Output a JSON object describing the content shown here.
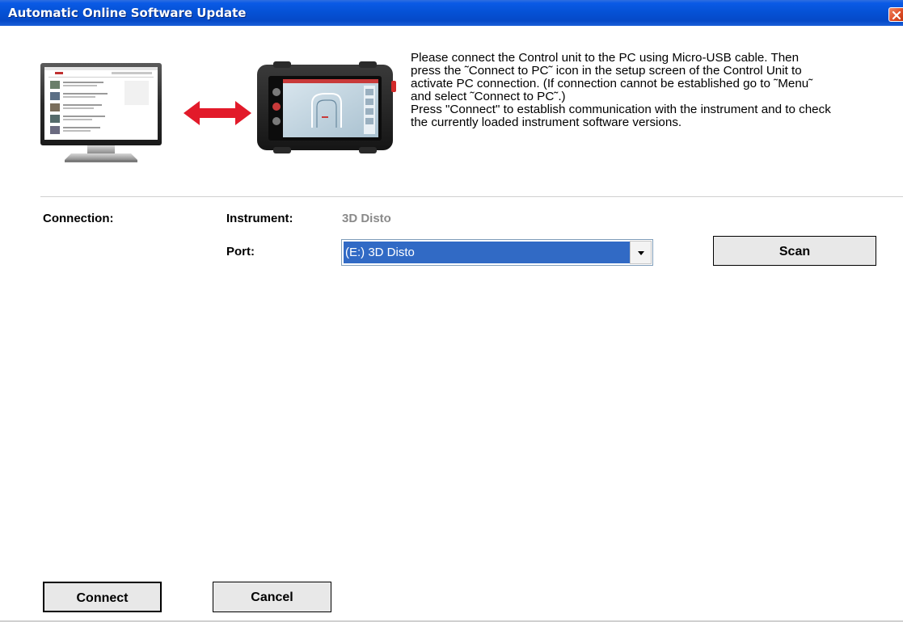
{
  "window": {
    "title": "Automatic Online Software Update"
  },
  "instructions": [
    "Please connect the Control unit to the PC using Micro-USB cable.  Then",
    "press the ˜Connect to PC˜ icon in the setup screen of the Control Unit to",
    "activate PC connection. (If connection cannot be established  go to ˜Menu˜",
    "and select ˜Connect to PC˜.)",
    "Press \"Connect\" to establish communication with the instrument and to check",
    "the currently loaded instrument software versions."
  ],
  "connection": {
    "section_label": "Connection:",
    "instrument_label": "Instrument:",
    "instrument_value": "3D Disto",
    "port_label": "Port:",
    "port_value": "(E:) 3D Disto"
  },
  "buttons": {
    "scan": "Scan",
    "connect": "Connect",
    "cancel": "Cancel"
  },
  "colors": {
    "titlebar": "#0552d6",
    "selection": "#316ac5",
    "arrow": "#e21a2a",
    "close_button": "#e0502a"
  },
  "icons": {
    "close": "close-icon",
    "dropdown": "chevron-down-icon",
    "arrow": "double-arrow-icon"
  }
}
